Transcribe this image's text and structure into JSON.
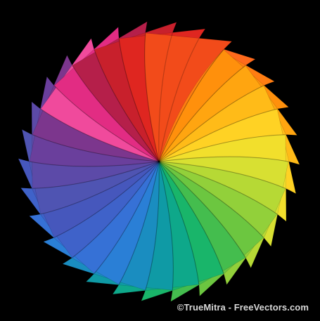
{
  "artwork": {
    "background_color": "#000000",
    "wheel": {
      "petal_count": 30,
      "colors": [
        "#ff6a1c",
        "#ff7d12",
        "#ff900c",
        "#ffa510",
        "#ffbb18",
        "#ffd224",
        "#f2df2c",
        "#d8e032",
        "#b6d935",
        "#92d03a",
        "#6cc640",
        "#44bd4e",
        "#19b56a",
        "#0ea88a",
        "#0f9aa5",
        "#1a8dc0",
        "#2a7fd6",
        "#3671d6",
        "#3f62c9",
        "#4657bc",
        "#4f54b2",
        "#5c4aa8",
        "#6a3f9c",
        "#7c368d",
        "#f04a9c",
        "#e22c83",
        "#b51f4a",
        "#c8202c",
        "#df2620",
        "#f24b1a"
      ]
    }
  },
  "credit": {
    "text": "©TrueMitra - FreeVectors.com"
  }
}
